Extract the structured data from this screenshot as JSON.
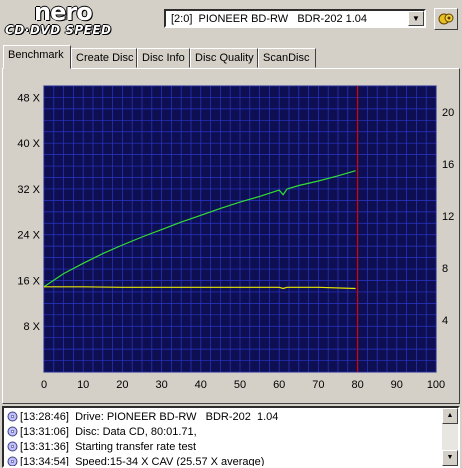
{
  "app": {
    "logo_main": "nero",
    "logo_sub": "CD·DVD SPEED"
  },
  "toolbar": {
    "drive_value": "[2:0]  PIONEER BD-RW   BDR-202 1.04",
    "dropdown_icon": "chevron-down-icon",
    "refresh_icon": "refresh-icon"
  },
  "tabs": [
    {
      "label": "Benchmark",
      "active": true
    },
    {
      "label": "Create Disc",
      "active": false
    },
    {
      "label": "Disc Info",
      "active": false
    },
    {
      "label": "Disc Quality",
      "active": false
    },
    {
      "label": "ScanDisc",
      "active": false
    }
  ],
  "chart_data": {
    "type": "line",
    "x_ticks": [
      "0",
      "10",
      "20",
      "30",
      "40",
      "50",
      "60",
      "70",
      "80",
      "90",
      "100"
    ],
    "y_left_ticks": [
      "8 X",
      "16 X",
      "24 X",
      "32 X",
      "40 X",
      "48 X"
    ],
    "y_right_ticks": [
      "4",
      "8",
      "12",
      "16",
      "20"
    ],
    "xlim": [
      0,
      100
    ],
    "ylim_left": [
      0,
      50
    ],
    "ylim_right": [
      0,
      22
    ],
    "grid": true,
    "end_marker_x": 80,
    "colors": {
      "background": "#0e0e52",
      "grid": "#2a36c8",
      "transfer": "#33dd33",
      "cpu": "#e6e600",
      "marker": "#dd0000"
    },
    "series": [
      {
        "axis": "left",
        "color": "#33dd33",
        "x": [
          0,
          5,
          10,
          15,
          20,
          25,
          30,
          35,
          40,
          45,
          50,
          55,
          60,
          61,
          62,
          65,
          70,
          75,
          79.5
        ],
        "y": [
          14.9,
          17.2,
          19.0,
          20.7,
          22.2,
          23.6,
          24.9,
          26.2,
          27.4,
          28.6,
          29.7,
          30.7,
          31.8,
          31.0,
          32.0,
          32.6,
          33.4,
          34.3,
          35.2
        ]
      },
      {
        "axis": "left",
        "color": "#e6e600",
        "x": [
          0,
          10,
          20,
          30,
          40,
          50,
          60,
          61,
          62,
          70,
          79.5
        ],
        "y": [
          14.9,
          14.9,
          14.8,
          14.8,
          14.8,
          14.8,
          14.8,
          14.6,
          14.8,
          14.8,
          14.6
        ]
      }
    ]
  },
  "log": {
    "icon": "disc-icon",
    "entries": [
      {
        "time": "[13:28:46]",
        "text": "Drive: PIONEER BD-RW   BDR-202  1.04"
      },
      {
        "time": "[13:31:06]",
        "text": "Disc: Data CD, 80:01.71,"
      },
      {
        "time": "[13:31:36]",
        "text": "Starting transfer rate test"
      },
      {
        "time": "[13:34:54]",
        "text": "Speed:15-34 X CAV (25.57 X average)"
      }
    ]
  }
}
